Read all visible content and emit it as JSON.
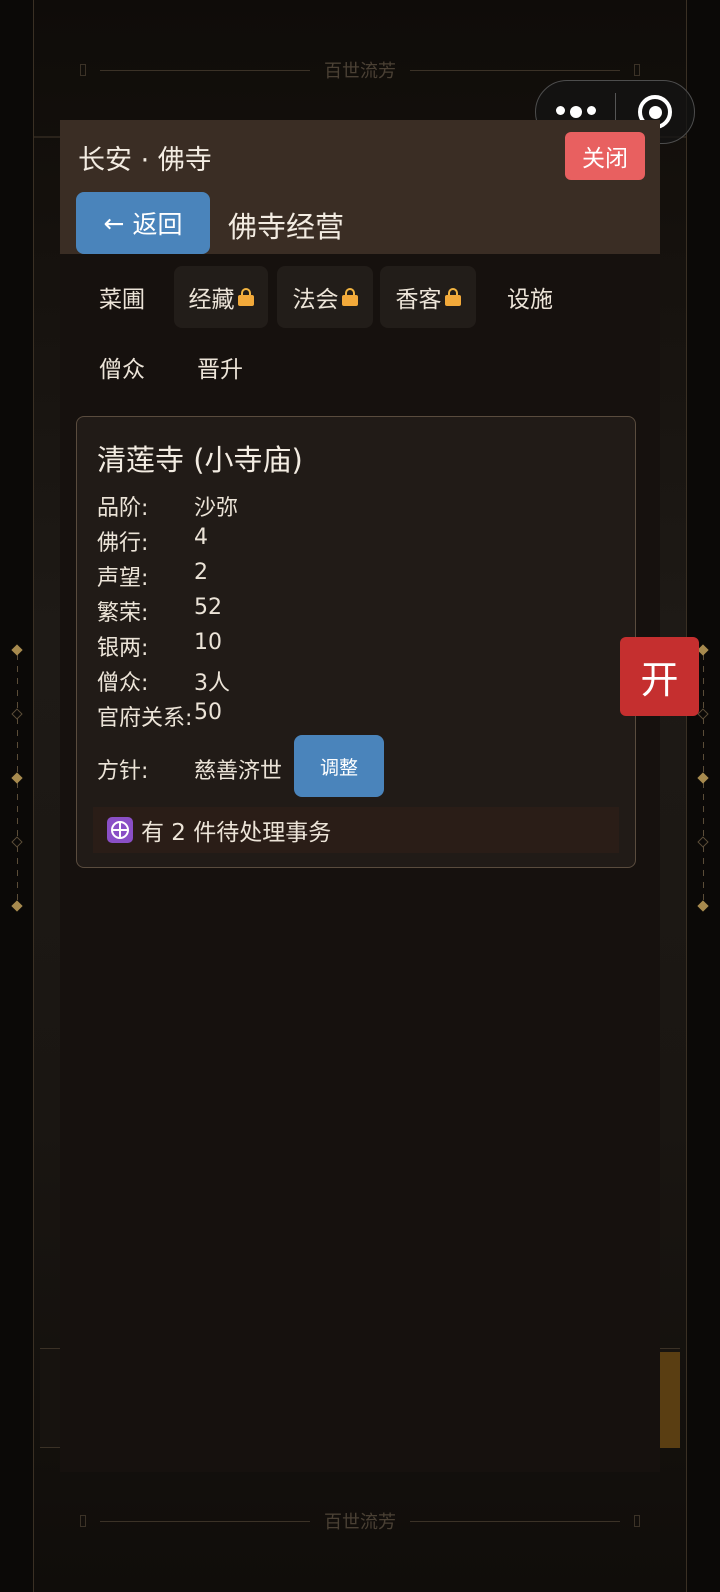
{
  "background": {
    "banner_text": "百世流芳"
  },
  "capsule": {
    "more_icon": "more-dots-icon",
    "close_icon": "target-circle-icon"
  },
  "header": {
    "title": "长安 · 佛寺",
    "close_label": "关闭",
    "back_label": "返回",
    "back_arrow": "←",
    "subtitle": "佛寺经营"
  },
  "tabs": [
    {
      "label": "菜圃",
      "locked": false
    },
    {
      "label": "经藏",
      "locked": true
    },
    {
      "label": "法会",
      "locked": true
    },
    {
      "label": "香客",
      "locked": true
    },
    {
      "label": "设施",
      "locked": false
    },
    {
      "label": "僧众",
      "locked": false
    },
    {
      "label": "晋升",
      "locked": false
    }
  ],
  "temple": {
    "name": "清莲寺 (小寺庙)",
    "stats": [
      {
        "key": "品阶:",
        "value": "沙弥"
      },
      {
        "key": "佛行:",
        "value": "4"
      },
      {
        "key": "声望:",
        "value": "2"
      },
      {
        "key": "繁荣:",
        "value": "52"
      },
      {
        "key": "银两:",
        "value": "10"
      },
      {
        "key": "僧众:",
        "value": "3人"
      },
      {
        "key": "官府关系:",
        "value": "50"
      }
    ],
    "policy_key": "方针:",
    "policy_value": "慈善济世",
    "adjust_label": "调整",
    "pending_text": "有 2 件待处理事务"
  },
  "open_label": "开",
  "colors": {
    "accent_blue": "#4a84bb",
    "close_red": "#e86060",
    "open_red": "#c52f2f",
    "header_brown": "#3a2d24",
    "lock_gold": "#f2a93a"
  }
}
